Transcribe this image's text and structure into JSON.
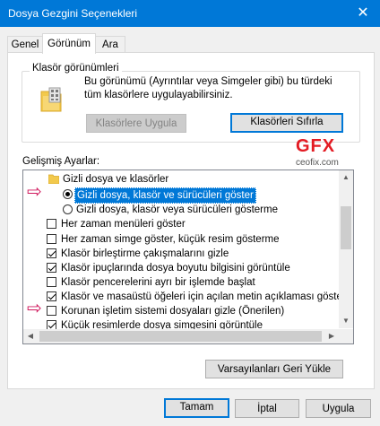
{
  "window": {
    "title": "Dosya Gezgini Seçenekleri",
    "close_glyph": "✕"
  },
  "tabs": [
    {
      "label": "Genel",
      "active": false
    },
    {
      "label": "Görünüm",
      "active": true
    },
    {
      "label": "Ara",
      "active": false
    }
  ],
  "folder_views": {
    "group_label": "Klasör görünümleri",
    "description": "Bu görünümü (Ayrıntılar veya Simgeler gibi) bu türdeki tüm klasörlere uygulayabilirsiniz.",
    "apply_button": "Klasörlere Uygula",
    "reset_button": "Klasörleri Sıfırla"
  },
  "advanced": {
    "label": "Gelişmiş Ayarlar:",
    "items": [
      {
        "type": "folder",
        "label": "Gizli dosya ve klasörler"
      },
      {
        "type": "radio",
        "label": "Gizli dosya, klasör ve sürücüleri göster",
        "checked": true,
        "selected": true
      },
      {
        "type": "radio",
        "label": "Gizli dosya, klasör veya sürücüleri gösterme",
        "checked": false
      },
      {
        "type": "checkbox",
        "label": "Her zaman menüleri göster",
        "checked": false
      },
      {
        "type": "checkbox",
        "label": "Her zaman simge göster, küçük resim gösterme",
        "checked": false
      },
      {
        "type": "checkbox",
        "label": "Klasör birleştirme çakışmalarını gizle",
        "checked": true
      },
      {
        "type": "checkbox",
        "label": "Klasör ipuçlarında dosya boyutu bilgisini görüntüle",
        "checked": true
      },
      {
        "type": "checkbox",
        "label": "Klasör pencerelerini ayrı bir işlemde başlat",
        "checked": false
      },
      {
        "type": "checkbox",
        "label": "Klasör ve masaüstü öğeleri için açılan metin açıklaması göster",
        "checked": true
      },
      {
        "type": "checkbox",
        "label": "Korunan işletim sistemi dosyaları gizle (Önerilen)",
        "checked": false
      },
      {
        "type": "checkbox",
        "label": "Küçük resimlerde dosya simgesini görüntüle",
        "checked": true
      }
    ]
  },
  "watermark": {
    "logo": "GFX",
    "site": "ceofix.com"
  },
  "restore_defaults_button": "Varsayılanları Geri Yükle",
  "footer": {
    "ok": "Tamam",
    "cancel": "İptal",
    "apply": "Uygula"
  },
  "colors": {
    "titlebar": "#0078d7",
    "selection": "#0078d7",
    "annotation_arrow": "#d0195d"
  }
}
